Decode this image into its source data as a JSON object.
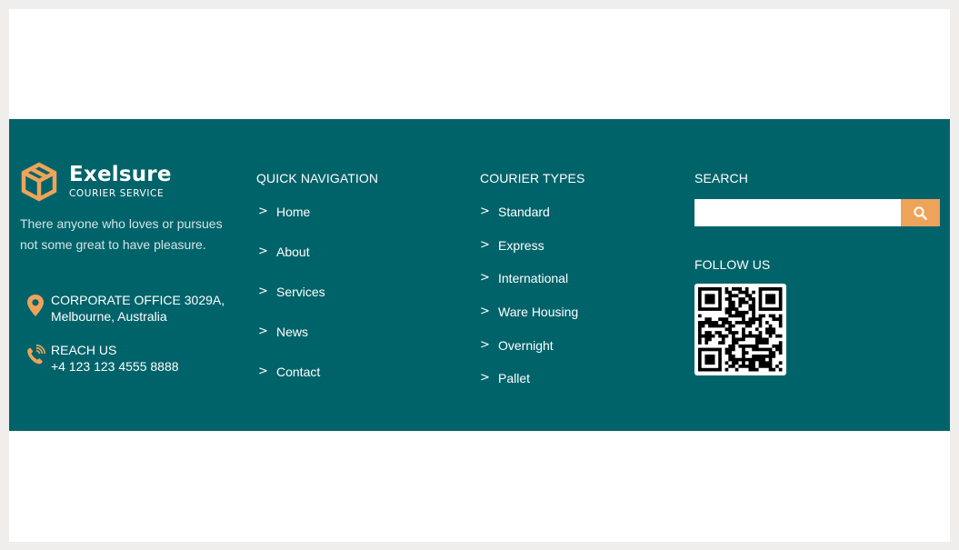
{
  "brand": {
    "name": "Exelsure",
    "tagline": "COURIER SERVICE",
    "accent_color": "#eda45a",
    "footer_color": "#01636a"
  },
  "about": {
    "text": "There anyone who loves or pursues not some great to have pleasure."
  },
  "contact": {
    "office": {
      "icon": "location-pin-icon",
      "line1": "CORPORATE OFFICE 3029A,",
      "line2": "Melbourne, Australia"
    },
    "reach": {
      "icon": "phone-icon",
      "line1": "REACH US",
      "line2": "+4 123 123 4555 8888"
    }
  },
  "quick_nav": {
    "heading": "QUICK NAVIGATION",
    "items": [
      "Home",
      "About",
      "Services",
      "News",
      "Contact"
    ]
  },
  "courier_types": {
    "heading": "COURIER TYPES",
    "items": [
      "Standard",
      "Express",
      "International",
      "Ware Housing",
      "Overnight",
      "Pallet"
    ]
  },
  "search": {
    "heading": "SEARCH",
    "placeholder": "",
    "button_icon": "search-icon"
  },
  "follow": {
    "heading": "FOLLOW US",
    "icon": "qr-code-icon"
  }
}
